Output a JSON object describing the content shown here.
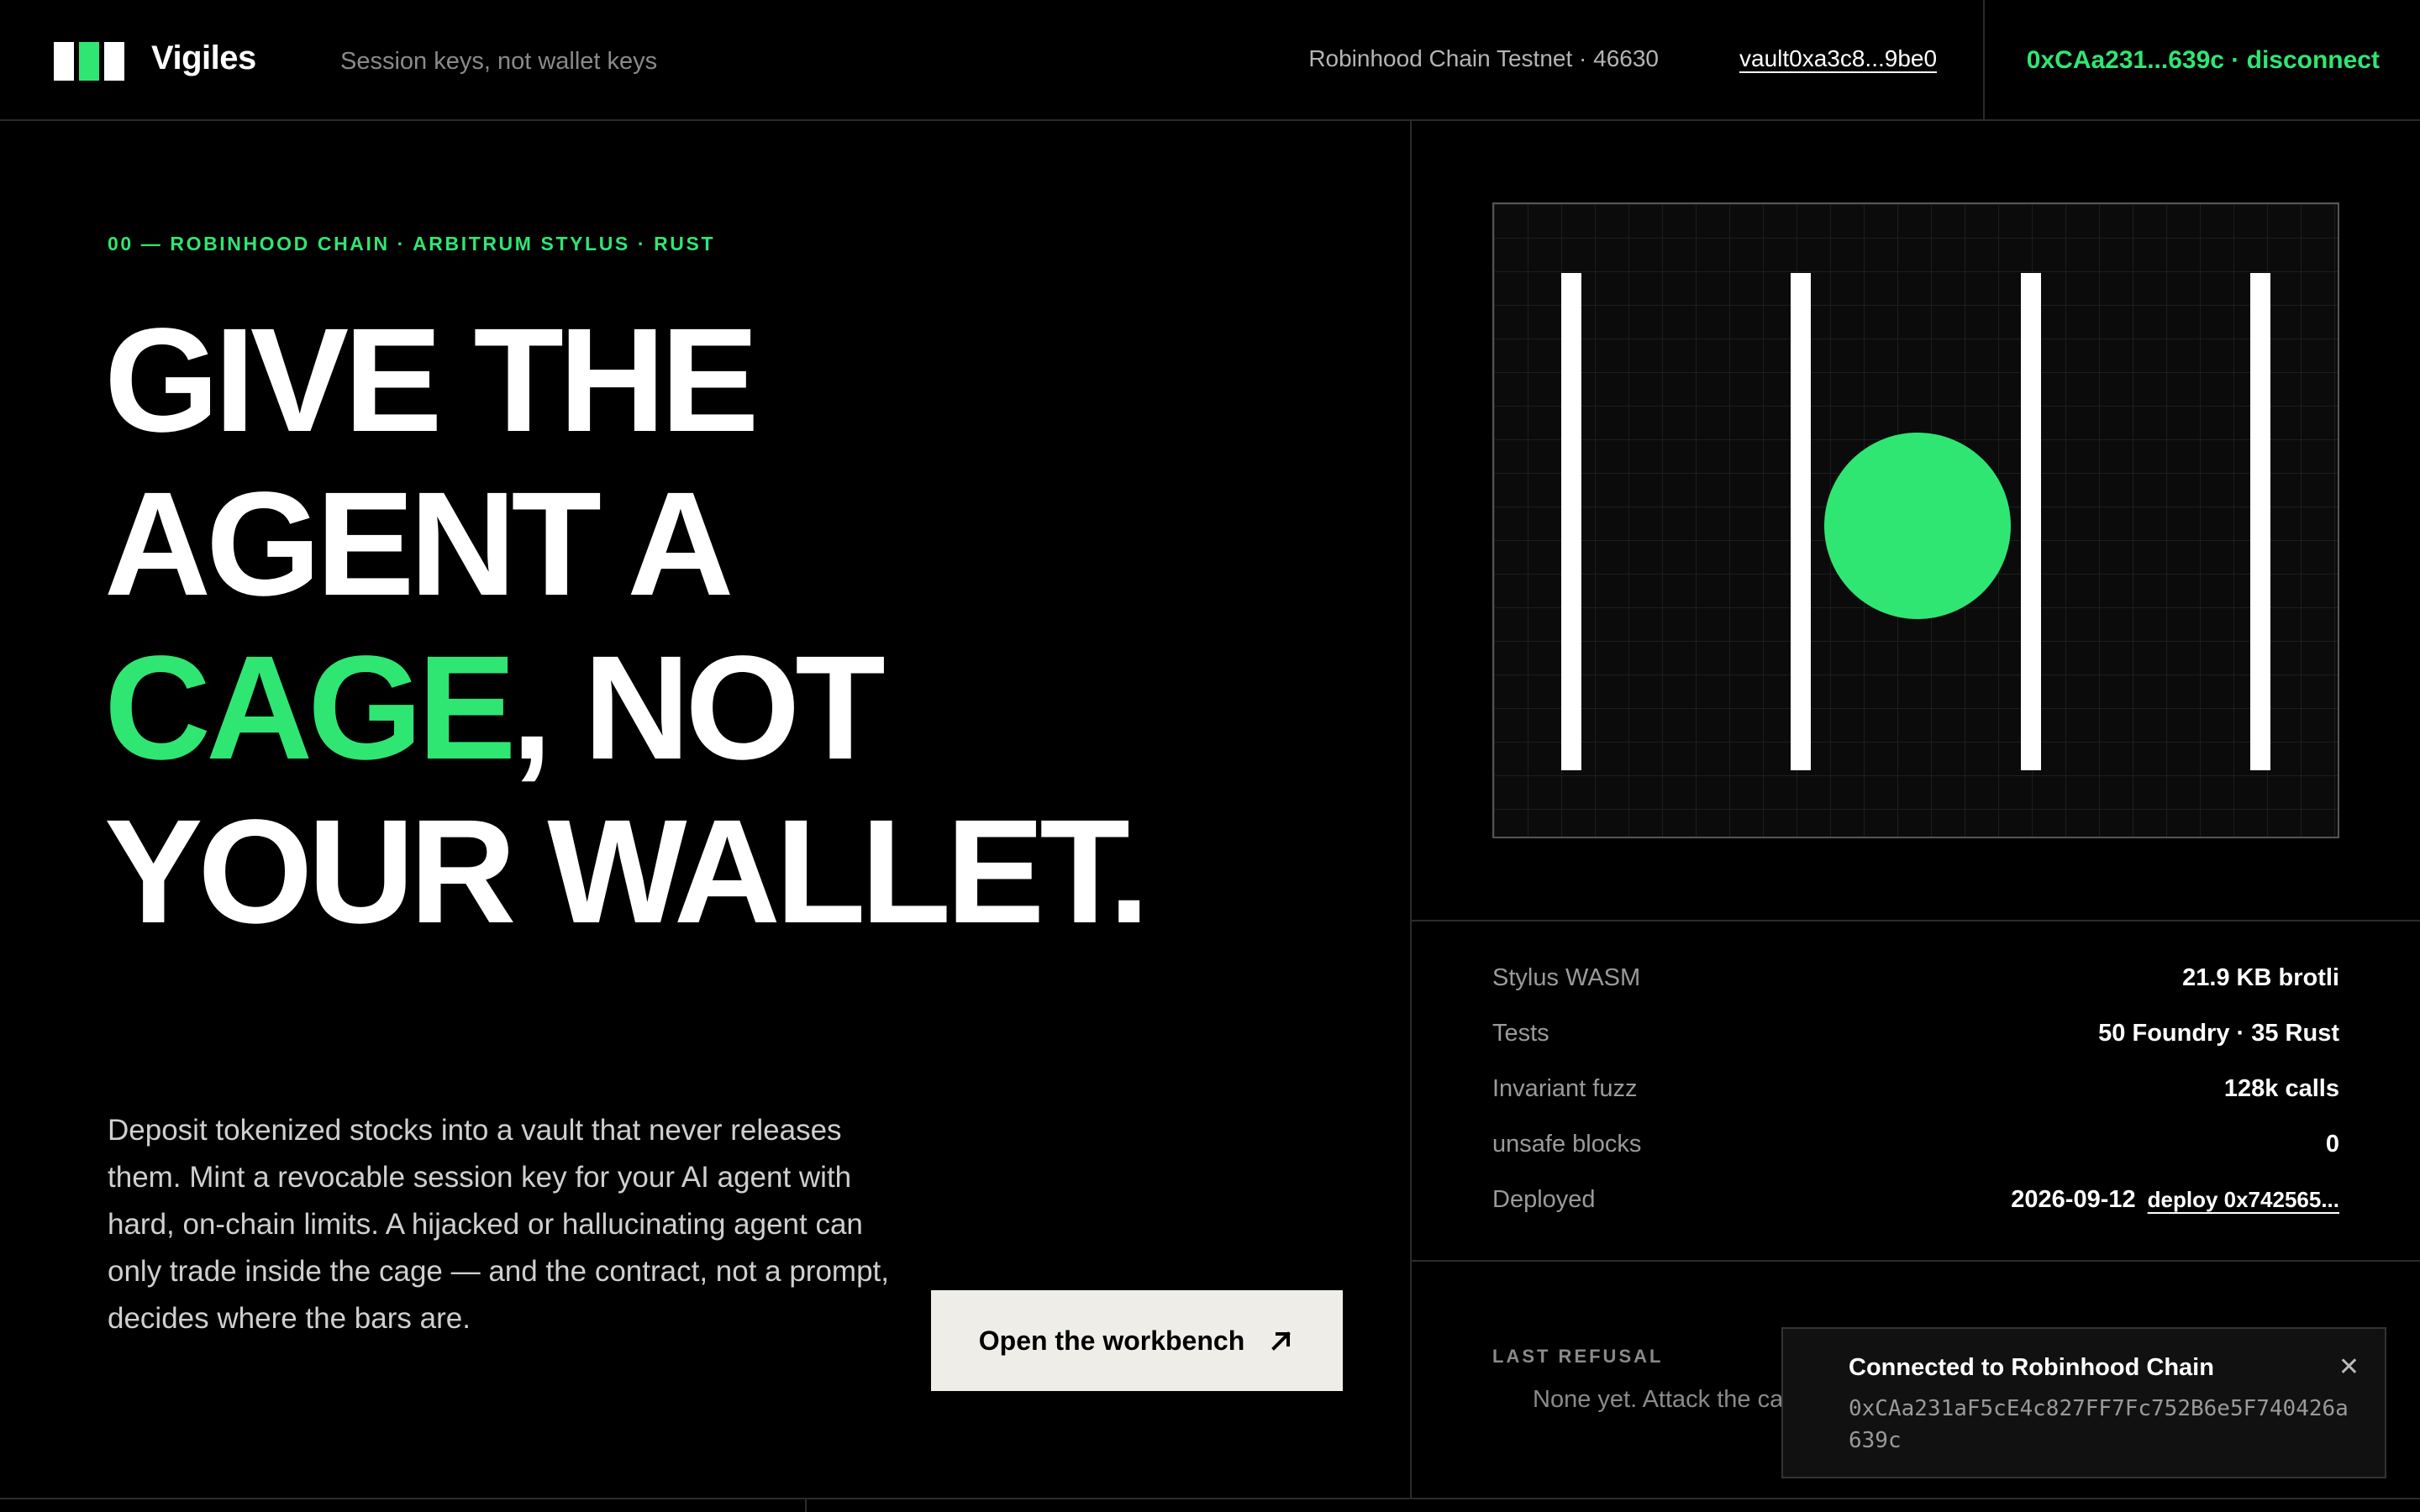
{
  "header": {
    "brand": "Vigiles",
    "tagline": "Session keys, not wallet keys",
    "network": "Robinhood Chain Testnet · 46630",
    "vault_link": "vault0xa3c8...9be0",
    "account": "0xCAa231...639c · disconnect"
  },
  "hero": {
    "eyebrow": "00 — ROBINHOOD CHAIN · ARBITRUM STYLUS · RUST",
    "headline": {
      "line1": "GIVE THE",
      "line2": "AGENT A",
      "accent_word": "CAGE",
      "line3_rest": ", NOT",
      "line4": "YOUR WALLET."
    },
    "description": "Deposit tokenized stocks into a vault that never releases them. Mint a revocable session key for your AI agent with hard, on-chain limits. A hijacked or hallucinating agent can only trade inside the cage — and the contract, not a prompt, decides where the bars are.",
    "cta_label": "Open the workbench",
    "cta_icon": "arrow-up-right-icon"
  },
  "stats": [
    {
      "label": "Stylus WASM",
      "value": "21.9 KB brotli"
    },
    {
      "label": "Tests",
      "value": "50 Foundry · 35 Rust"
    },
    {
      "label": "Invariant fuzz",
      "value": "128k calls"
    },
    {
      "label": "unsafe blocks",
      "value": "0"
    },
    {
      "label": "Deployed",
      "value": "2026-09-12",
      "link": "deploy 0x742565..."
    }
  ],
  "refusal": {
    "label": "LAST REFUSAL",
    "text": "None yet. Attack the ca"
  },
  "toast": {
    "title": "Connected to Robinhood Chain",
    "address": "0xCAa231aF5cE4c827FF7Fc752B6e5F740426a639c",
    "close_icon": "close-icon"
  },
  "colors": {
    "accent": "#2fe673",
    "background": "#000000",
    "cta_background": "#eeede8"
  }
}
